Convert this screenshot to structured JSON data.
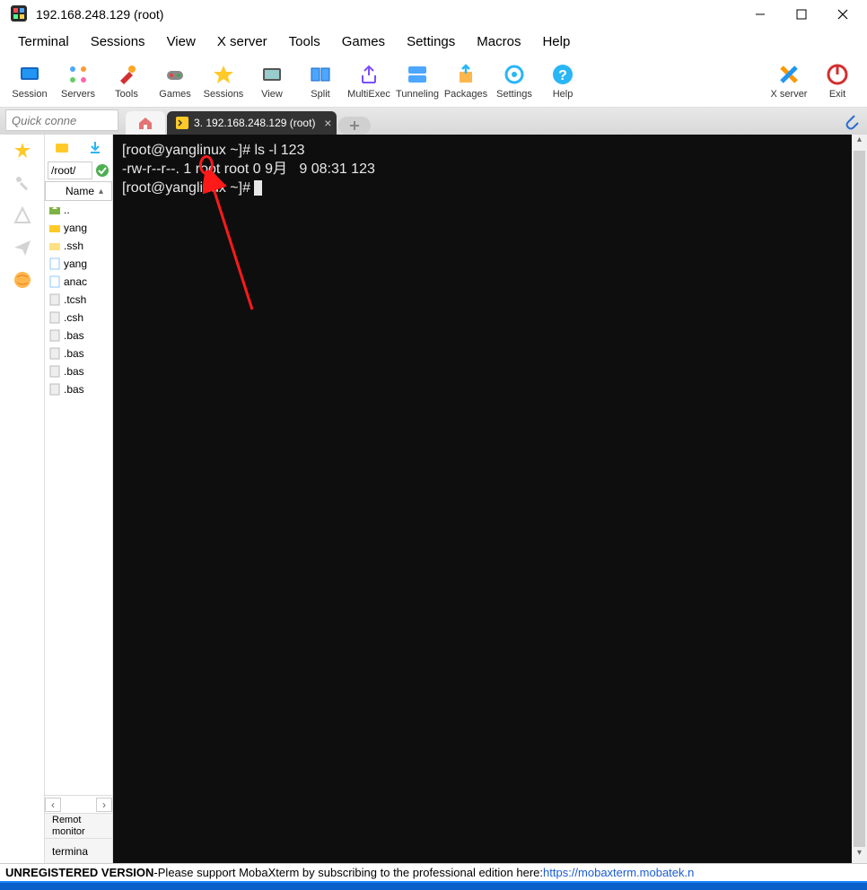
{
  "window": {
    "title": "192.168.248.129 (root)"
  },
  "menu": [
    "Terminal",
    "Sessions",
    "View",
    "X server",
    "Tools",
    "Games",
    "Settings",
    "Macros",
    "Help"
  ],
  "toolbar": [
    {
      "label": "Session",
      "icon": "session"
    },
    {
      "label": "Servers",
      "icon": "servers"
    },
    {
      "label": "Tools",
      "icon": "tools"
    },
    {
      "label": "Games",
      "icon": "games"
    },
    {
      "label": "Sessions",
      "icon": "sessions"
    },
    {
      "label": "View",
      "icon": "view"
    },
    {
      "label": "Split",
      "icon": "split"
    },
    {
      "label": "MultiExec",
      "icon": "multiexec"
    },
    {
      "label": "Tunneling",
      "icon": "tunneling"
    },
    {
      "label": "Packages",
      "icon": "packages"
    },
    {
      "label": "Settings",
      "icon": "settings"
    },
    {
      "label": "Help",
      "icon": "help"
    }
  ],
  "toolbar_right": [
    {
      "label": "X server",
      "icon": "xserver"
    },
    {
      "label": "Exit",
      "icon": "exit"
    }
  ],
  "quick_connect": {
    "placeholder": "Quick conne"
  },
  "tabs": {
    "active": {
      "label": "3. 192.168.248.129 (root)"
    },
    "add": "+"
  },
  "sidepanel": {
    "path": "/root/",
    "header": "Name",
    "items": [
      {
        "name": "..",
        "type": "up"
      },
      {
        "name": "yang",
        "type": "folder-yellow"
      },
      {
        "name": ".ssh",
        "type": "folder"
      },
      {
        "name": "yang",
        "type": "file"
      },
      {
        "name": "anac",
        "type": "file"
      },
      {
        "name": ".tcsh",
        "type": "hidden"
      },
      {
        "name": ".csh",
        "type": "hidden"
      },
      {
        "name": ".bas",
        "type": "hidden"
      },
      {
        "name": ".bas",
        "type": "hidden"
      },
      {
        "name": ".bas",
        "type": "hidden"
      },
      {
        "name": ".bas",
        "type": "hidden"
      }
    ],
    "bottom_buttons": [
      "Remot monitor",
      "termina"
    ]
  },
  "terminal": {
    "lines": [
      {
        "prompt": "[root@yanglinux ~]# ",
        "cmd": "ls -l 123"
      },
      {
        "text": "-rw-r--r--. 1 root root 0 9月   9 08:31 123"
      },
      {
        "prompt": "[root@yanglinux ~]# ",
        "cmd": ""
      }
    ]
  },
  "status": {
    "unregistered": "UNREGISTERED VERSION",
    "sep": "  -  ",
    "msg": "Please support MobaXterm by subscribing to the professional edition here:  ",
    "link": "https://mobaxterm.mobatek.n"
  }
}
